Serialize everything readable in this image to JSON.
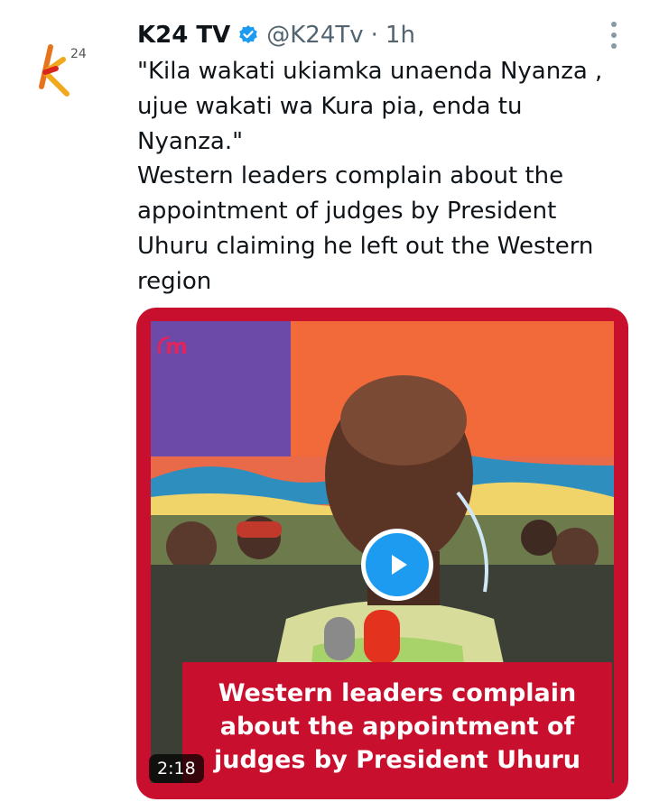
{
  "tweet": {
    "author_name": "K24 TV",
    "handle": "@K24Tv",
    "separator": "·",
    "time": "1h",
    "text_lines": [
      "\"Kila wakati ukiamka unaenda Nyanza ,",
      "ujue wakati wa Kura pia, enda tu",
      "Nyanza.\"",
      "Western leaders complain about the",
      "appointment of judges by President",
      "Uhuru claiming he left out the Western",
      "region"
    ],
    "text": "\"Kila wakati ukiamka unaenda Nyanza ,\nujue wakati wa Kura pia, enda tu\nNyanza.\"\nWestern leaders complain about the\nappointment of judges by President\nUhuru claiming he left out the Western\nregion"
  },
  "video": {
    "caption": "Western leaders complain about the appointment of judges by President Uhuru",
    "duration": "2:18",
    "watermark": "m"
  },
  "icons": {
    "avatar": "k24-logo",
    "verified": "verified-badge-icon",
    "more": "more-vertical-icon",
    "play": "play-icon"
  },
  "colors": {
    "accent": "#1d9bf0",
    "brand_red": "#c8102e",
    "muted": "#536471"
  }
}
